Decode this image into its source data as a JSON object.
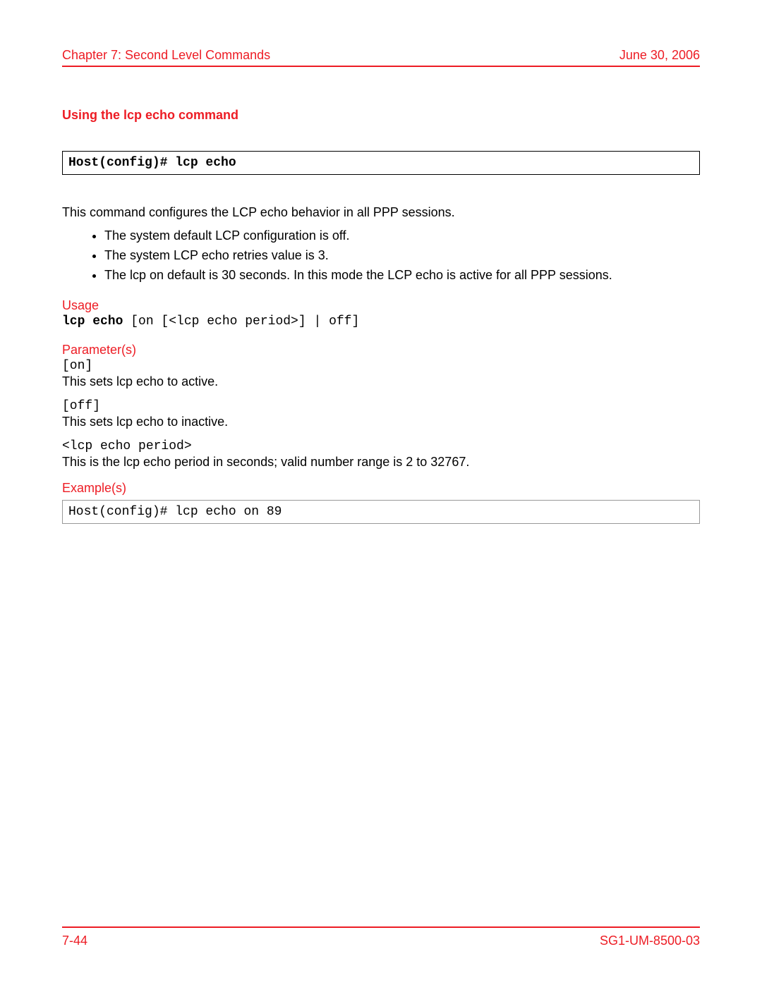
{
  "header": {
    "chapter": "Chapter 7: Second Level Commands",
    "date": "June 30, 2006"
  },
  "section_title": "Using the lcp echo command",
  "command_box": "Host(config)# lcp echo",
  "intro": "This command configures the LCP echo behavior in all PPP sessions.",
  "bullets": [
    "The system default LCP configuration is off.",
    "The system LCP echo retries value is 3.",
    "The lcp on default is 30 seconds. In this mode the LCP echo is active for all PPP sessions."
  ],
  "usage": {
    "heading": "Usage",
    "cmd_bold": "lcp echo",
    "cmd_rest": " [on [<lcp echo period>] | off]"
  },
  "parameters": {
    "heading": "Parameter(s)",
    "items": [
      {
        "code": "[on]",
        "desc": "This sets lcp echo to active."
      },
      {
        "code": "[off]",
        "desc": "This sets lcp echo to inactive."
      },
      {
        "code": "<lcp echo period>",
        "desc": "This is the lcp echo period in seconds; valid number range is 2 to 32767."
      }
    ]
  },
  "examples": {
    "heading": "Example(s)",
    "code": "Host(config)# lcp echo on 89"
  },
  "footer": {
    "page": "7-44",
    "docid": "SG1-UM-8500-03"
  }
}
